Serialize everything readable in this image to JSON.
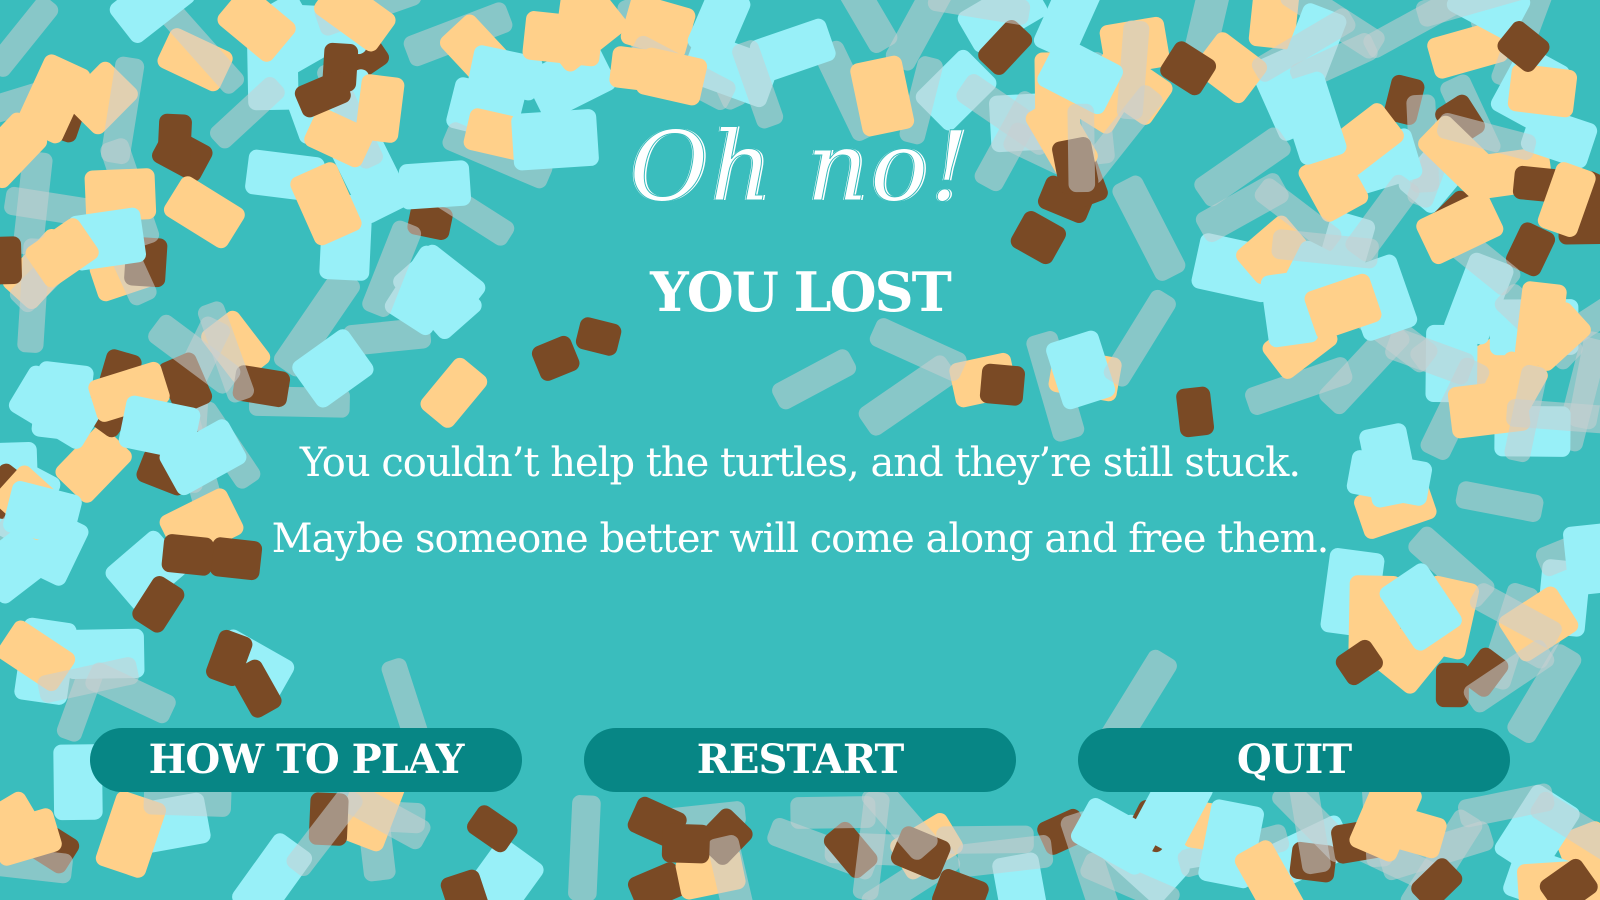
{
  "screen": {
    "heading": "Oh no!",
    "subheading": "YOU LOST",
    "message_lines": [
      "You couldn’t help the turtles, and they’re still stuck.",
      "Maybe someone better will come along and free them."
    ]
  },
  "buttons": {
    "how_to_play": "HOW TO PLAY",
    "restart": "RESTART",
    "quit": "QUIT"
  },
  "colors": {
    "background": "#3abdbd",
    "button": "#078685",
    "text": "#ffffff",
    "confetti_brown": "#7a4a25",
    "confetti_peach": "#ffd08a",
    "confetti_cyan": "#98f0f8",
    "confetti_grey": "#c9cfd1"
  }
}
